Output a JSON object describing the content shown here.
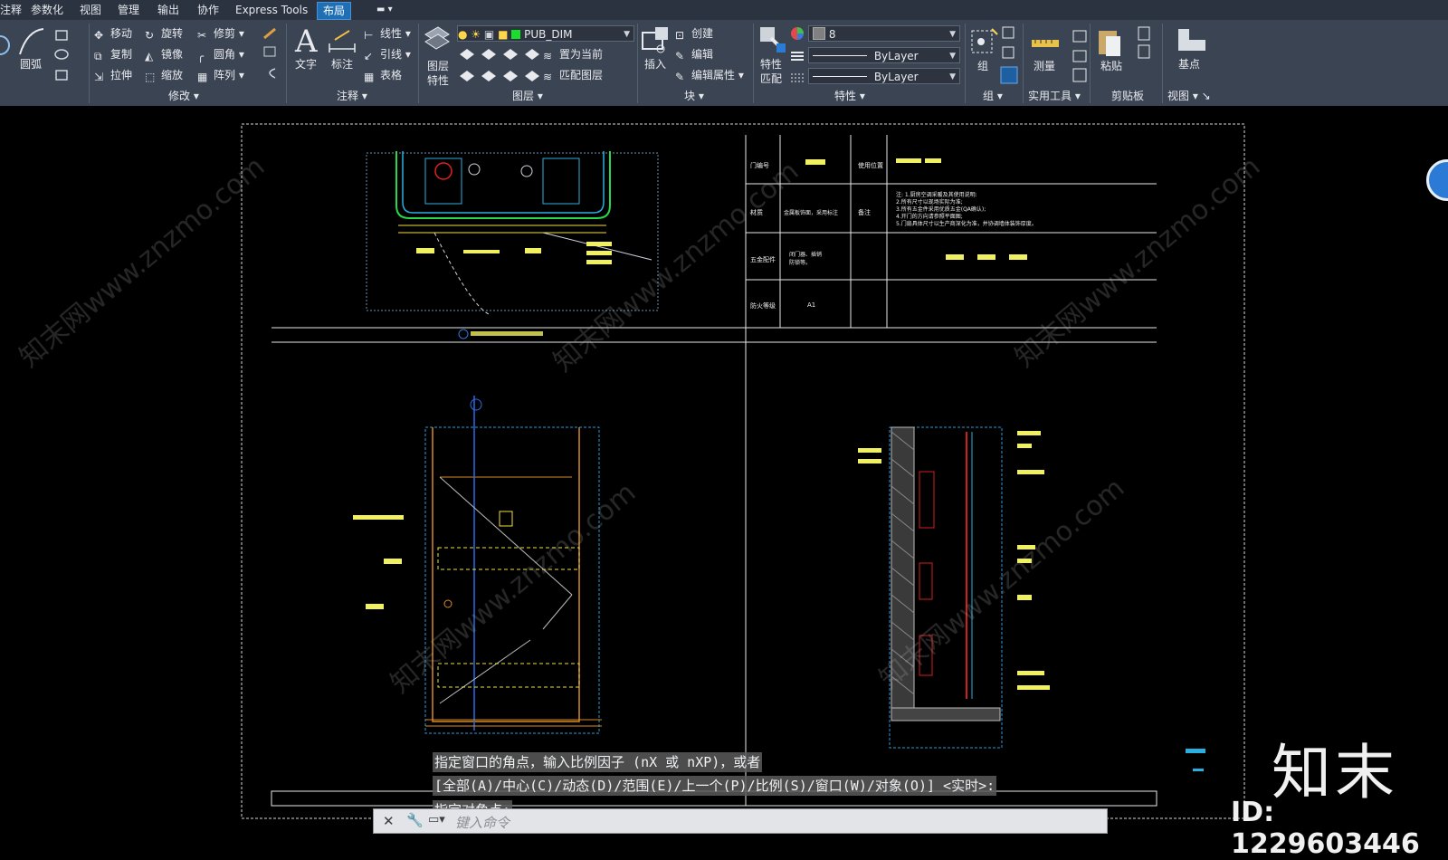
{
  "menu": {
    "tabs": [
      "注释",
      "参数化",
      "视图",
      "管理",
      "输出",
      "协作",
      "Express Tools",
      "布局"
    ],
    "active_tab": "布局"
  },
  "ribbon": {
    "draw": {
      "arc_label": "圆弧"
    },
    "modify": {
      "title": "修改",
      "buttons": [
        "移动",
        "旋转",
        "修剪",
        "复制",
        "镜像",
        "圆角",
        "拉伸",
        "缩放",
        "阵列"
      ]
    },
    "annotation": {
      "title": "注释",
      "text_label": "文字",
      "dim_label": "标注",
      "linear_label": "线性",
      "leader_label": "引线",
      "table_label": "表格"
    },
    "layers": {
      "title": "图层",
      "layer_props_label1": "图层",
      "layer_props_label2": "特性",
      "current_layer": "PUB_DIM",
      "set_current_label": "置为当前",
      "match_layer_label": "匹配图层"
    },
    "block": {
      "title": "块",
      "insert_label": "插入",
      "create_label": "创建",
      "edit_label": "编辑",
      "edit_attr_label": "编辑属性"
    },
    "properties": {
      "title": "特性",
      "match_label1": "特性",
      "match_label2": "匹配",
      "color_value": "8",
      "linetype_value": "ByLayer",
      "lineweight_value": "ByLayer"
    },
    "groups": {
      "title": "组",
      "group_label": "组"
    },
    "utilities": {
      "title": "实用工具",
      "measure_label": "测量"
    },
    "clipboard": {
      "title": "剪贴板",
      "paste_label": "粘贴"
    },
    "view": {
      "title": "视图",
      "base_label": "基点"
    }
  },
  "drawing": {
    "table": {
      "rows": [
        {
          "label": "门编号",
          "note_label": "使用位置"
        },
        {
          "label": "材质",
          "value": "金属板饰面，采用标注",
          "note_label": "备注",
          "notes": [
            "注: 1.厨房空调采暖及其使用说明:",
            "2.所有尺寸以现场实际为准;",
            "3.所有五金件采用优质五金(QA确认);",
            "4.开门的方向请参照平面图;",
            "5.门扇具体尺寸以生产商深化为准，并协调墙体装饰厚度。"
          ]
        },
        {
          "label": "五金配件",
          "value": "闭门器、插销\n防锁等。"
        },
        {
          "label": "防火等级",
          "value": "A1"
        }
      ]
    }
  },
  "command_line": {
    "line1": "指定窗口的角点，输入比例因子 (nX 或 nXP)，或者",
    "line2": "[全部(A)/中心(C)/动态(D)/范围(E)/上一个(P)/比例(S)/窗口(W)/对象(O)] <实时>:",
    "line3": "指定对角点:",
    "placeholder": "键入命令"
  },
  "watermark": {
    "brand": "知末",
    "id_text": "ID: 1229603446",
    "site": "知末网www.znzmo.com"
  }
}
